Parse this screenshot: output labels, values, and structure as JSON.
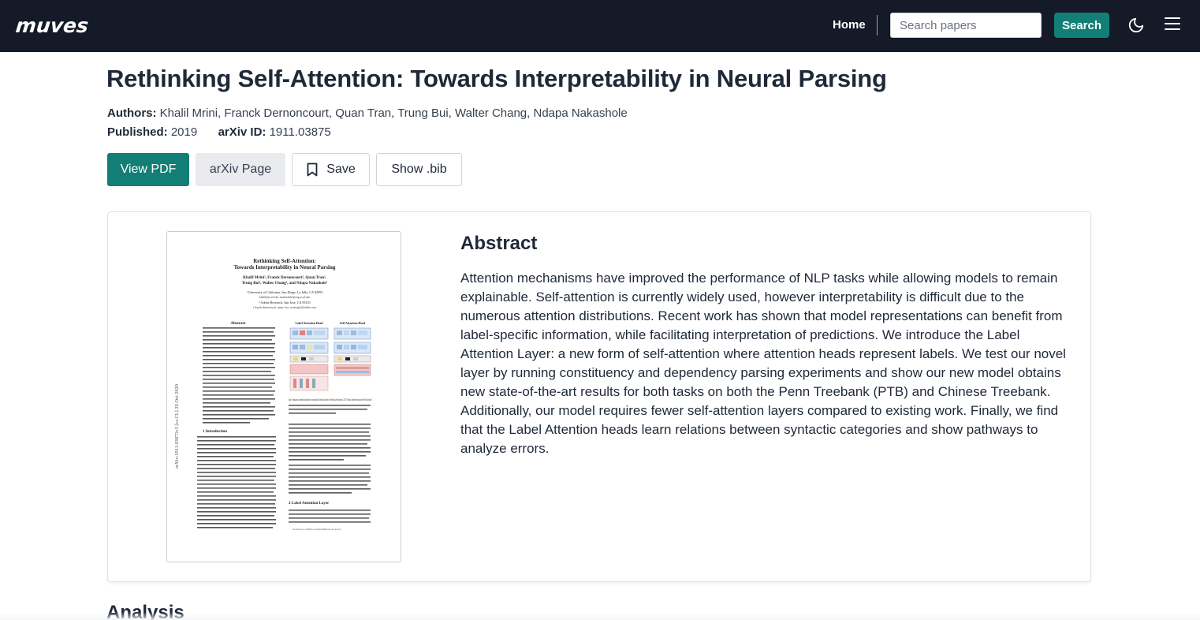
{
  "navbar": {
    "logo": "muves",
    "home_label": "Home",
    "search_placeholder": "Search papers",
    "search_button": "Search",
    "theme_icon": "moon-icon",
    "menu_icon": "hamburger-menu-icon"
  },
  "paper": {
    "title": "Rethinking Self-Attention: Towards Interpretability in Neural Parsing",
    "authors_label": "Authors:",
    "authors": "Khalil Mrini, Franck Dernoncourt, Quan Tran, Trung Bui, Walter Chang, Ndapa Nakashole",
    "published_label": "Published:",
    "published": "2019",
    "arxiv_label": "arXiv ID:",
    "arxiv_id": "1911.03875"
  },
  "actions": {
    "view_pdf": "View PDF",
    "arxiv_page": "arXiv Page",
    "save": "Save",
    "save_icon": "bookmark-icon",
    "show_bib": "Show .bib"
  },
  "abstract": {
    "heading": "Abstract",
    "text": "Attention mechanisms have improved the performance of NLP tasks while allowing models to remain explainable. Self-attention is currently widely used, however interpretability is difficult due to the numerous attention distributions. Recent work has shown that model representations can benefit from label-specific information, while facilitating interpretation of predictions. We introduce the Label Attention Layer: a new form of self-attention where attention heads represent labels. We test our novel layer by running constituency and dependency parsing experiments and show our new model obtains new state-of-the-art results for both tasks on both the Penn Treebank (PTB) and Chinese Treebank. Additionally, our model requires fewer self-attention layers compared to existing work. Finally, we find that the Label Attention heads learn relations between syntactic categories and show pathways to analyze errors."
  },
  "thumbnail": {
    "title_line1": "Rethinking Self-Attention:",
    "title_line2": "Towards Interpretability in Neural Parsing",
    "authors_line1": "Khalil Mrini¹, Franck Dernoncourt², Quan Tran²,",
    "authors_line2": "Trung Bui², Walter Chang², and Ndapa Nakashole¹",
    "affil1": "¹ University of California, San Diego, La Jolla, CA 92093",
    "affil1_email": "khalil@ucsd.edu, nnakashole@eng.ucsd.edu",
    "affil2": "² Adobe Research, San Jose, CA 95110",
    "affil2_email": "{franck.dernoncourt, qtran, bui, wachang}@adobe.com",
    "side_text": "arXiv:1911.03875v3 [cs.CL] 29 Oct 2020",
    "abstract_heading": "Abstract",
    "fig_head1": "Label Attention Head",
    "fig_head2": "Self-Attention Head",
    "caption": "Figure 1: Comparison of the attention head architecture of our proposed Label Attention Layer and a Self-Attention Layer (Vaswani et al., 2017). The matrix X represents the input sentence \"Select the person\".",
    "section1": "1   Introduction",
    "section2": "2   Label Attention Layer",
    "footnote": "¹ Available at: GitHub.com/KhalilMrini/LAL-Parser"
  },
  "analysis": {
    "heading": "Analysis"
  },
  "colors": {
    "navbar": "#141a28",
    "accent": "#127e75",
    "secondary_button": "#e9ebef"
  }
}
